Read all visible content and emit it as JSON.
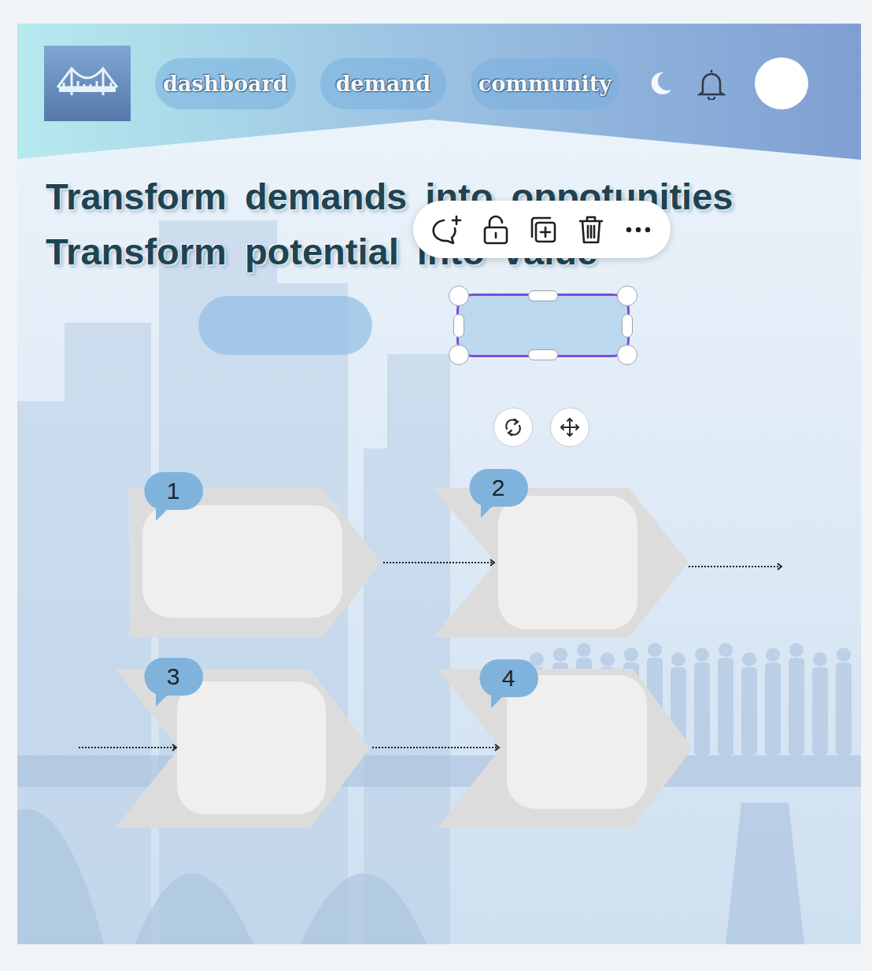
{
  "nav": {
    "items": [
      {
        "label": "dashboard"
      },
      {
        "label": "demand"
      },
      {
        "label": "community"
      }
    ]
  },
  "headline": {
    "lines": [
      "Transform demands into oppotunities",
      "Transform potential into value"
    ]
  },
  "shapes": [
    {
      "selected": false
    },
    {
      "selected": true
    }
  ],
  "steps": [
    {
      "number": "1"
    },
    {
      "number": "2"
    },
    {
      "number": "3"
    },
    {
      "number": "4"
    }
  ]
}
